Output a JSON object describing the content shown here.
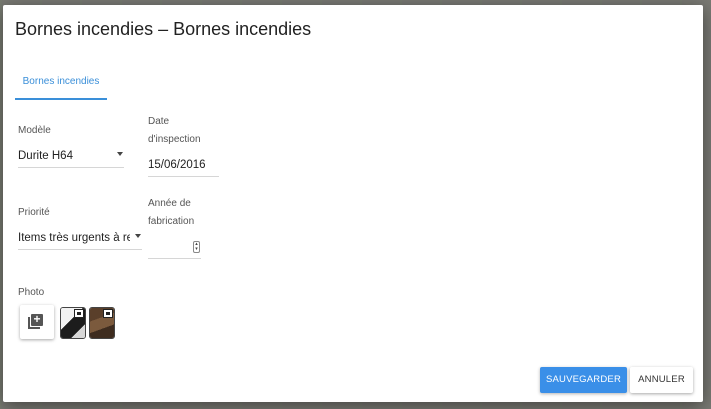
{
  "dialog": {
    "title": "Bornes incendies – Bornes incendies",
    "tabs": [
      {
        "label": "Bornes incendies",
        "active": true
      }
    ]
  },
  "form": {
    "modele": {
      "label": "Modèle",
      "value": "Durite H64"
    },
    "date_inspection": {
      "label_line1": "Date",
      "label_line2": "d'inspection",
      "value": "15/06/2016"
    },
    "priorite": {
      "label": "Priorité",
      "value": "Items très urgents à re"
    },
    "annee_fabrication": {
      "label_line1": "Année de",
      "label_line2": "fabrication",
      "value": ""
    },
    "photo": {
      "label": "Photo"
    }
  },
  "icons": {
    "add_photo": "add-photo-icon",
    "caret": "dropdown-caret-icon",
    "spinner": "number-spinner-icon"
  },
  "buttons": {
    "save": "SAUVEGARDER",
    "cancel": "ANNULER"
  },
  "colors": {
    "accent": "#3a8fe8",
    "tab_active": "#3a8fd9"
  }
}
